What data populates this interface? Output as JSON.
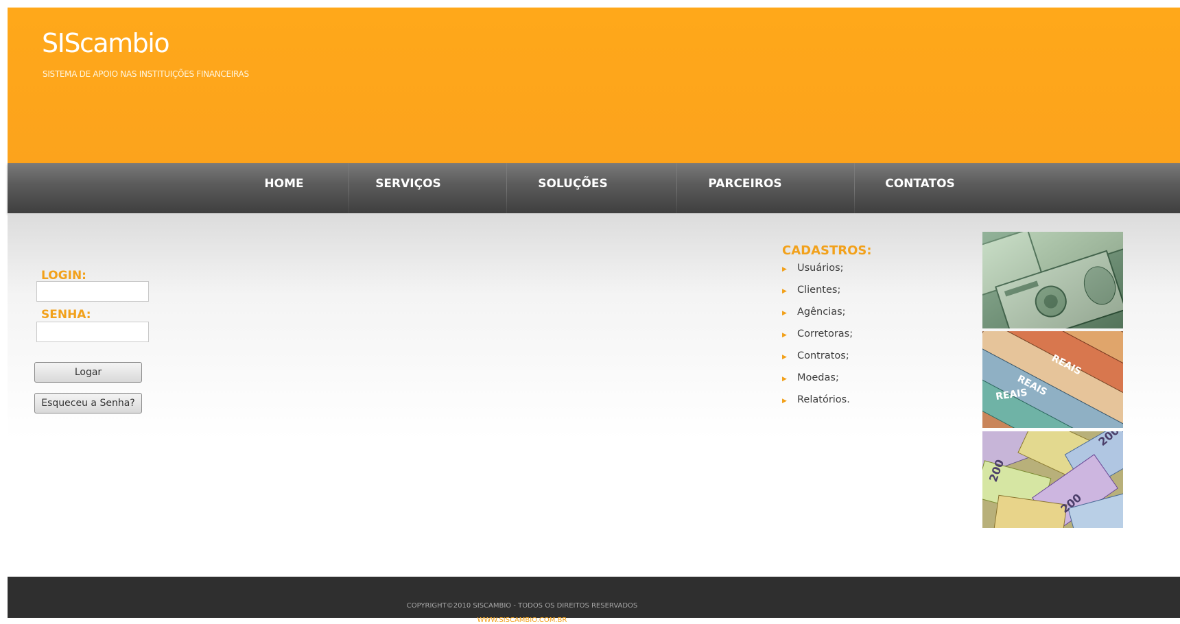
{
  "brand": {
    "name": "SIScambio",
    "tagline": "SISTEMA DE APOIO NAS INSTITUIÇÕES FINANCEIRAS",
    "colors": {
      "header": "#ffa81a",
      "accent": "#f2a11b",
      "nav": "#4a4a4a",
      "footer": "#2f2f2f"
    }
  },
  "nav": {
    "items": [
      {
        "label": "HOME"
      },
      {
        "label": "SERVIÇOS"
      },
      {
        "label": "SOLUÇÕES"
      },
      {
        "label": "PARCEIROS"
      },
      {
        "label": "CONTATOS"
      }
    ]
  },
  "login": {
    "login_label": "LOGIN:",
    "login_value": "",
    "senha_label": "SENHA:",
    "senha_value": "",
    "submit_label": "Logar",
    "forgot_label": "Esqueceu a Senha?"
  },
  "cadastros": {
    "title": "CADASTROS:",
    "bullet_icon": "triangle-right-icon",
    "items": [
      {
        "label": "Usuários;"
      },
      {
        "label": "Clientes;"
      },
      {
        "label": "Agências;"
      },
      {
        "label": "Corretoras;"
      },
      {
        "label": "Contratos;"
      },
      {
        "label": "Moedas;"
      },
      {
        "label": "Relatórios."
      }
    ]
  },
  "images": [
    {
      "name": "dollar-banknotes-image",
      "text": ""
    },
    {
      "name": "reais-banknotes-image",
      "text": "REAIS"
    },
    {
      "name": "euro-banknotes-image",
      "text": "200"
    }
  ],
  "footer": {
    "copyright": "COPYRIGHT©2010 SISCAMBIO - TODOS OS DIREITOS RESERVADOS",
    "url": "WWW.SISCAMBIO.COM.BR"
  }
}
